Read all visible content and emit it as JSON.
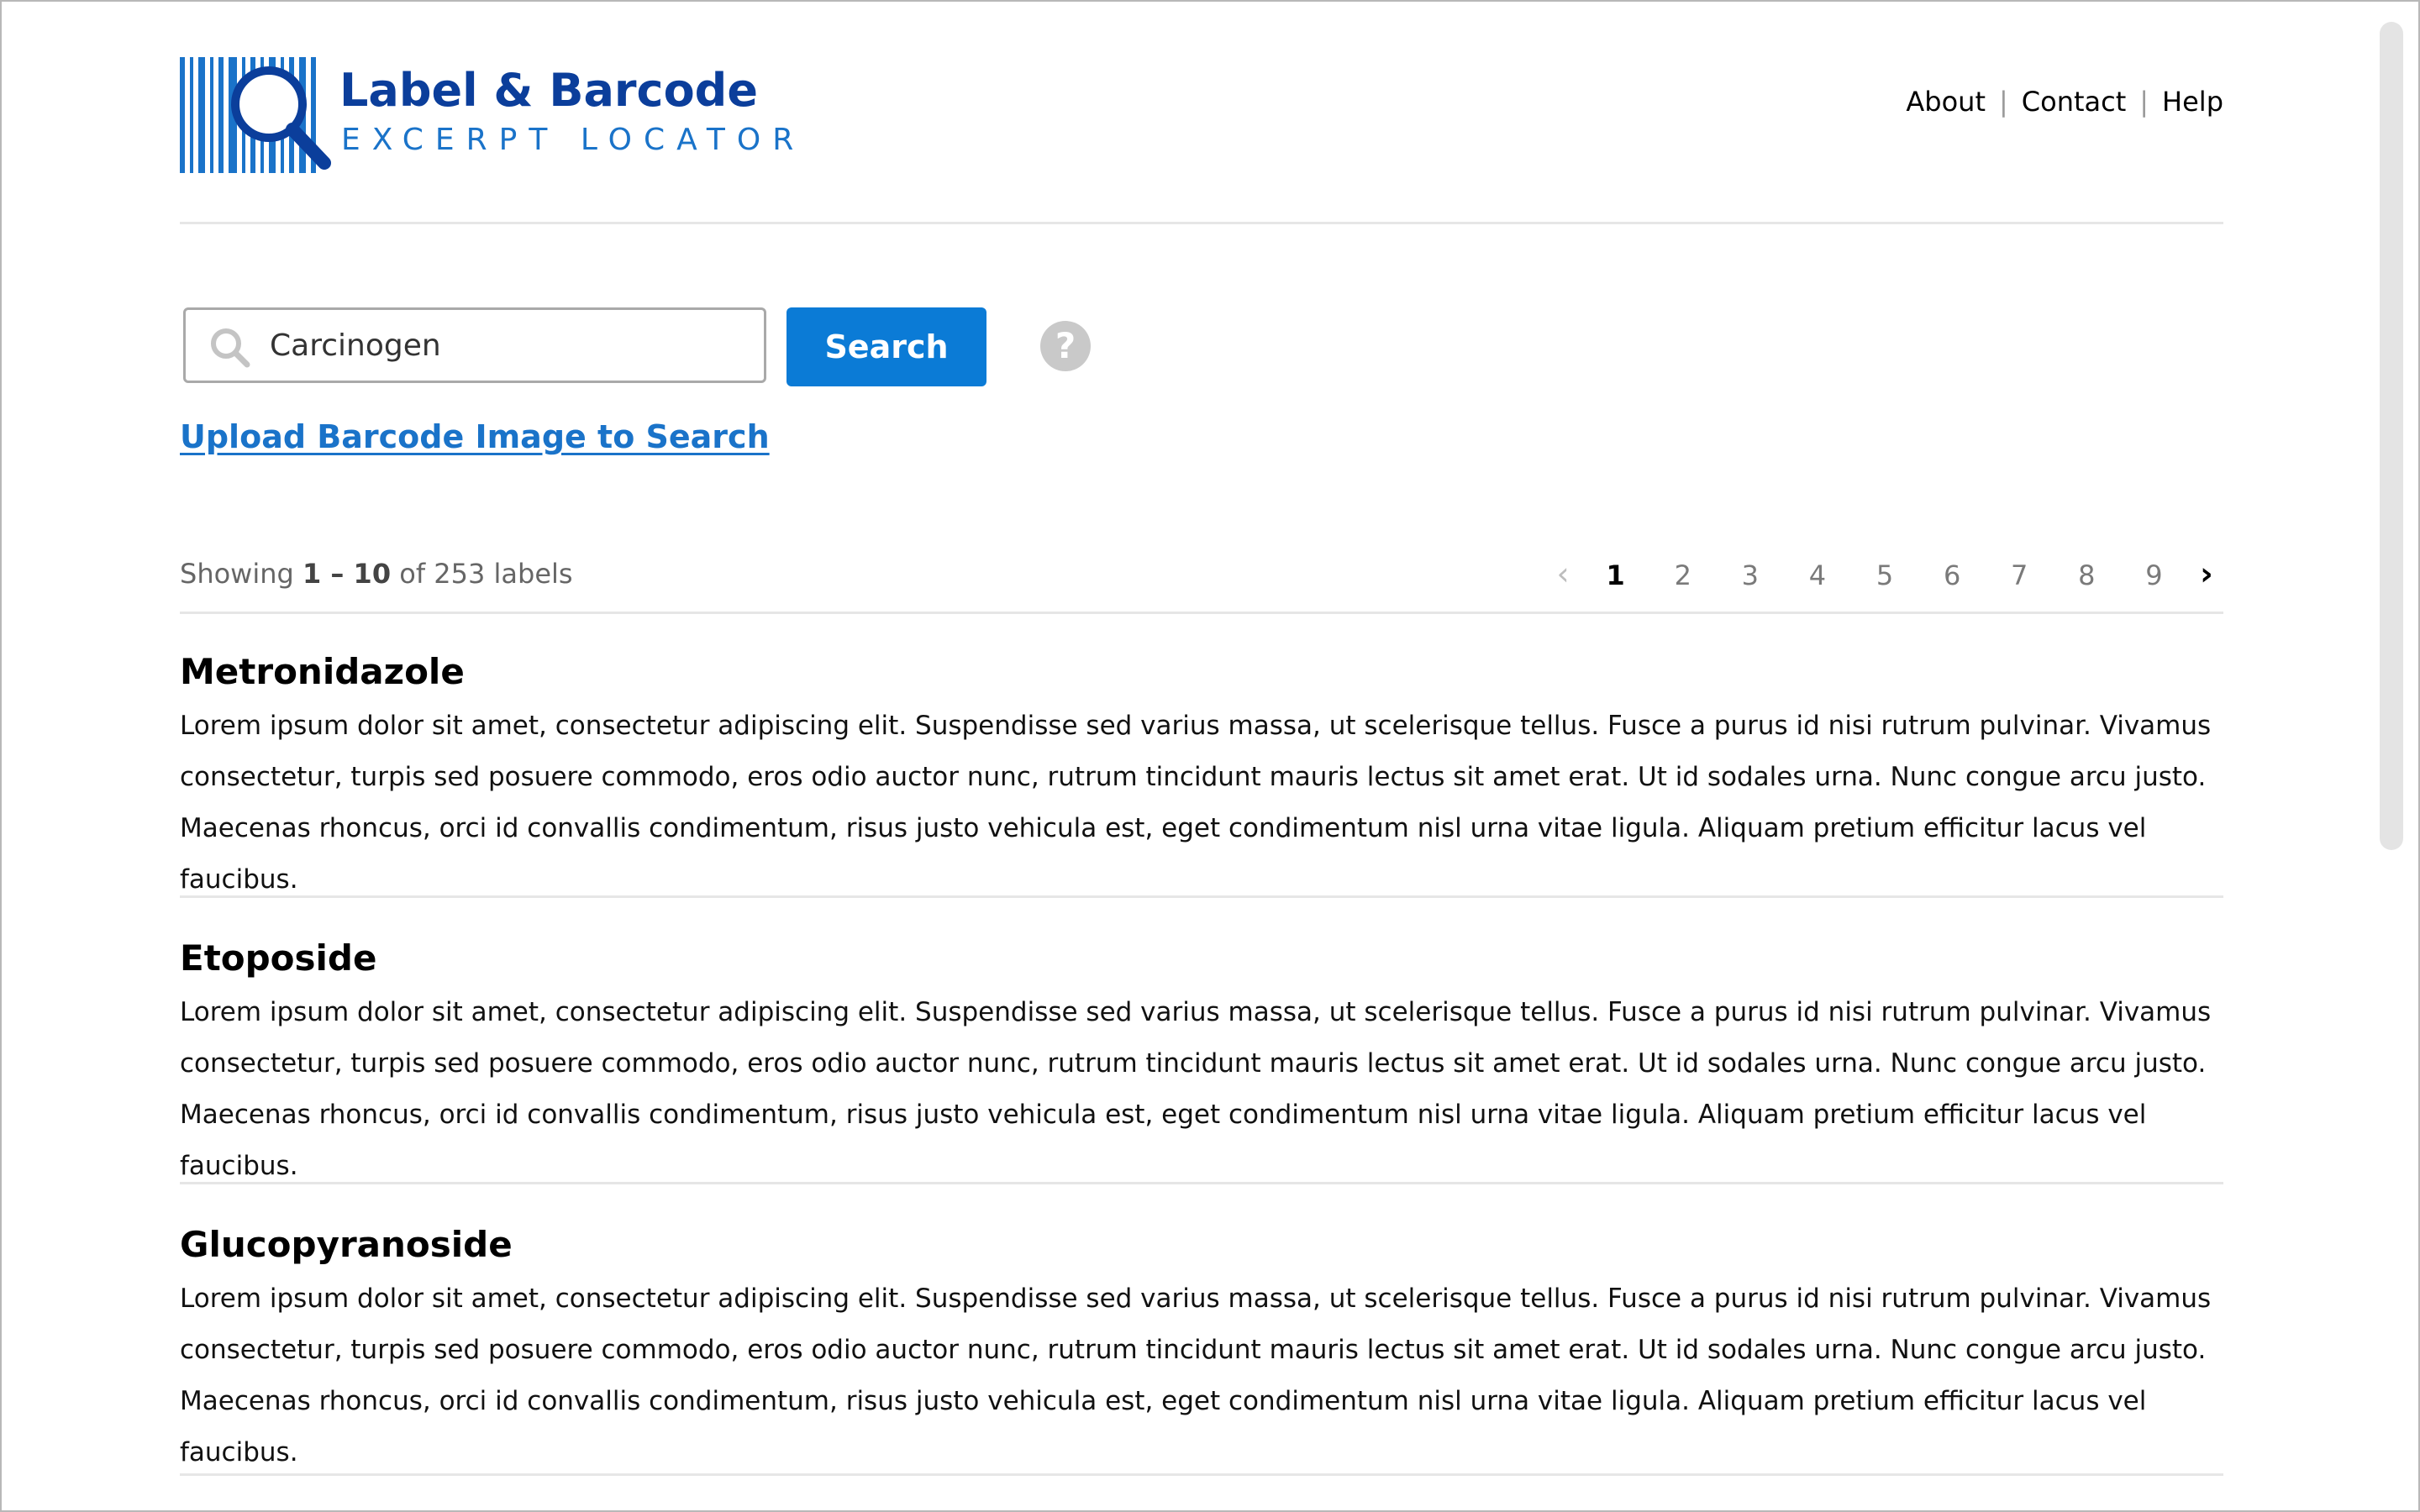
{
  "app": {
    "logo_title": "Label & Barcode",
    "logo_subtitle": "EXCERPT LOCATOR"
  },
  "nav": {
    "items": [
      "About",
      "Contact",
      "Help"
    ],
    "separator": "|"
  },
  "search": {
    "value": "Carcinogen",
    "placeholder": "",
    "button_label": "Search",
    "help_icon": "?",
    "upload_link": "Upload Barcode Image to Search"
  },
  "results": {
    "showing_prefix": "Showing",
    "range": "1 – 10",
    "suffix": "of 253 labels",
    "pagination": {
      "prev_icon": "‹",
      "next_icon": "›",
      "pages": [
        "1",
        "2",
        "3",
        "4",
        "5",
        "6",
        "7",
        "8",
        "9"
      ],
      "current": "1"
    },
    "items": [
      {
        "title": "Metronidazole",
        "description": "Lorem ipsum dolor sit amet, consectetur adipiscing elit. Suspendisse sed varius massa, ut scelerisque tellus. Fusce a purus id nisi rutrum pulvinar. Vivamus consectetur, turpis sed posuere commodo, eros odio auctor nunc, rutrum tincidunt mauris lectus sit amet erat. Ut id sodales urna. Nunc congue arcu justo. Maecenas rhoncus, orci id convallis condimentum, risus justo vehicula est, eget condimentum nisl urna vitae ligula. Aliquam pretium efficitur lacus vel faucibus."
      },
      {
        "title": "Etoposide",
        "description": "Lorem ipsum dolor sit amet, consectetur adipiscing elit. Suspendisse sed varius massa, ut scelerisque tellus. Fusce a purus id nisi rutrum pulvinar. Vivamus consectetur, turpis sed posuere commodo, eros odio auctor nunc, rutrum tincidunt mauris lectus sit amet erat. Ut id sodales urna. Nunc congue arcu justo. Maecenas rhoncus, orci id convallis condimentum, risus justo vehicula est, eget condimentum nisl urna vitae ligula. Aliquam pretium efficitur lacus vel faucibus."
      },
      {
        "title": "Glucopyranoside",
        "description": "Lorem ipsum dolor sit amet, consectetur adipiscing elit. Suspendisse sed varius massa, ut scelerisque tellus. Fusce a purus id nisi rutrum pulvinar. Vivamus consectetur, turpis sed posuere commodo, eros odio auctor nunc, rutrum tincidunt mauris lectus sit amet erat. Ut id sodales urna. Nunc congue arcu justo. Maecenas rhoncus, orci id convallis condimentum, risus justo vehicula est, eget condimentum nisl urna vitae ligula. Aliquam pretium efficitur lacus vel faucibus."
      }
    ]
  },
  "colors": {
    "brand_dark": "#0b3e9b",
    "brand_light": "#1a73c9",
    "button": "#0b7bd6",
    "rule": "#e6e6e6"
  }
}
